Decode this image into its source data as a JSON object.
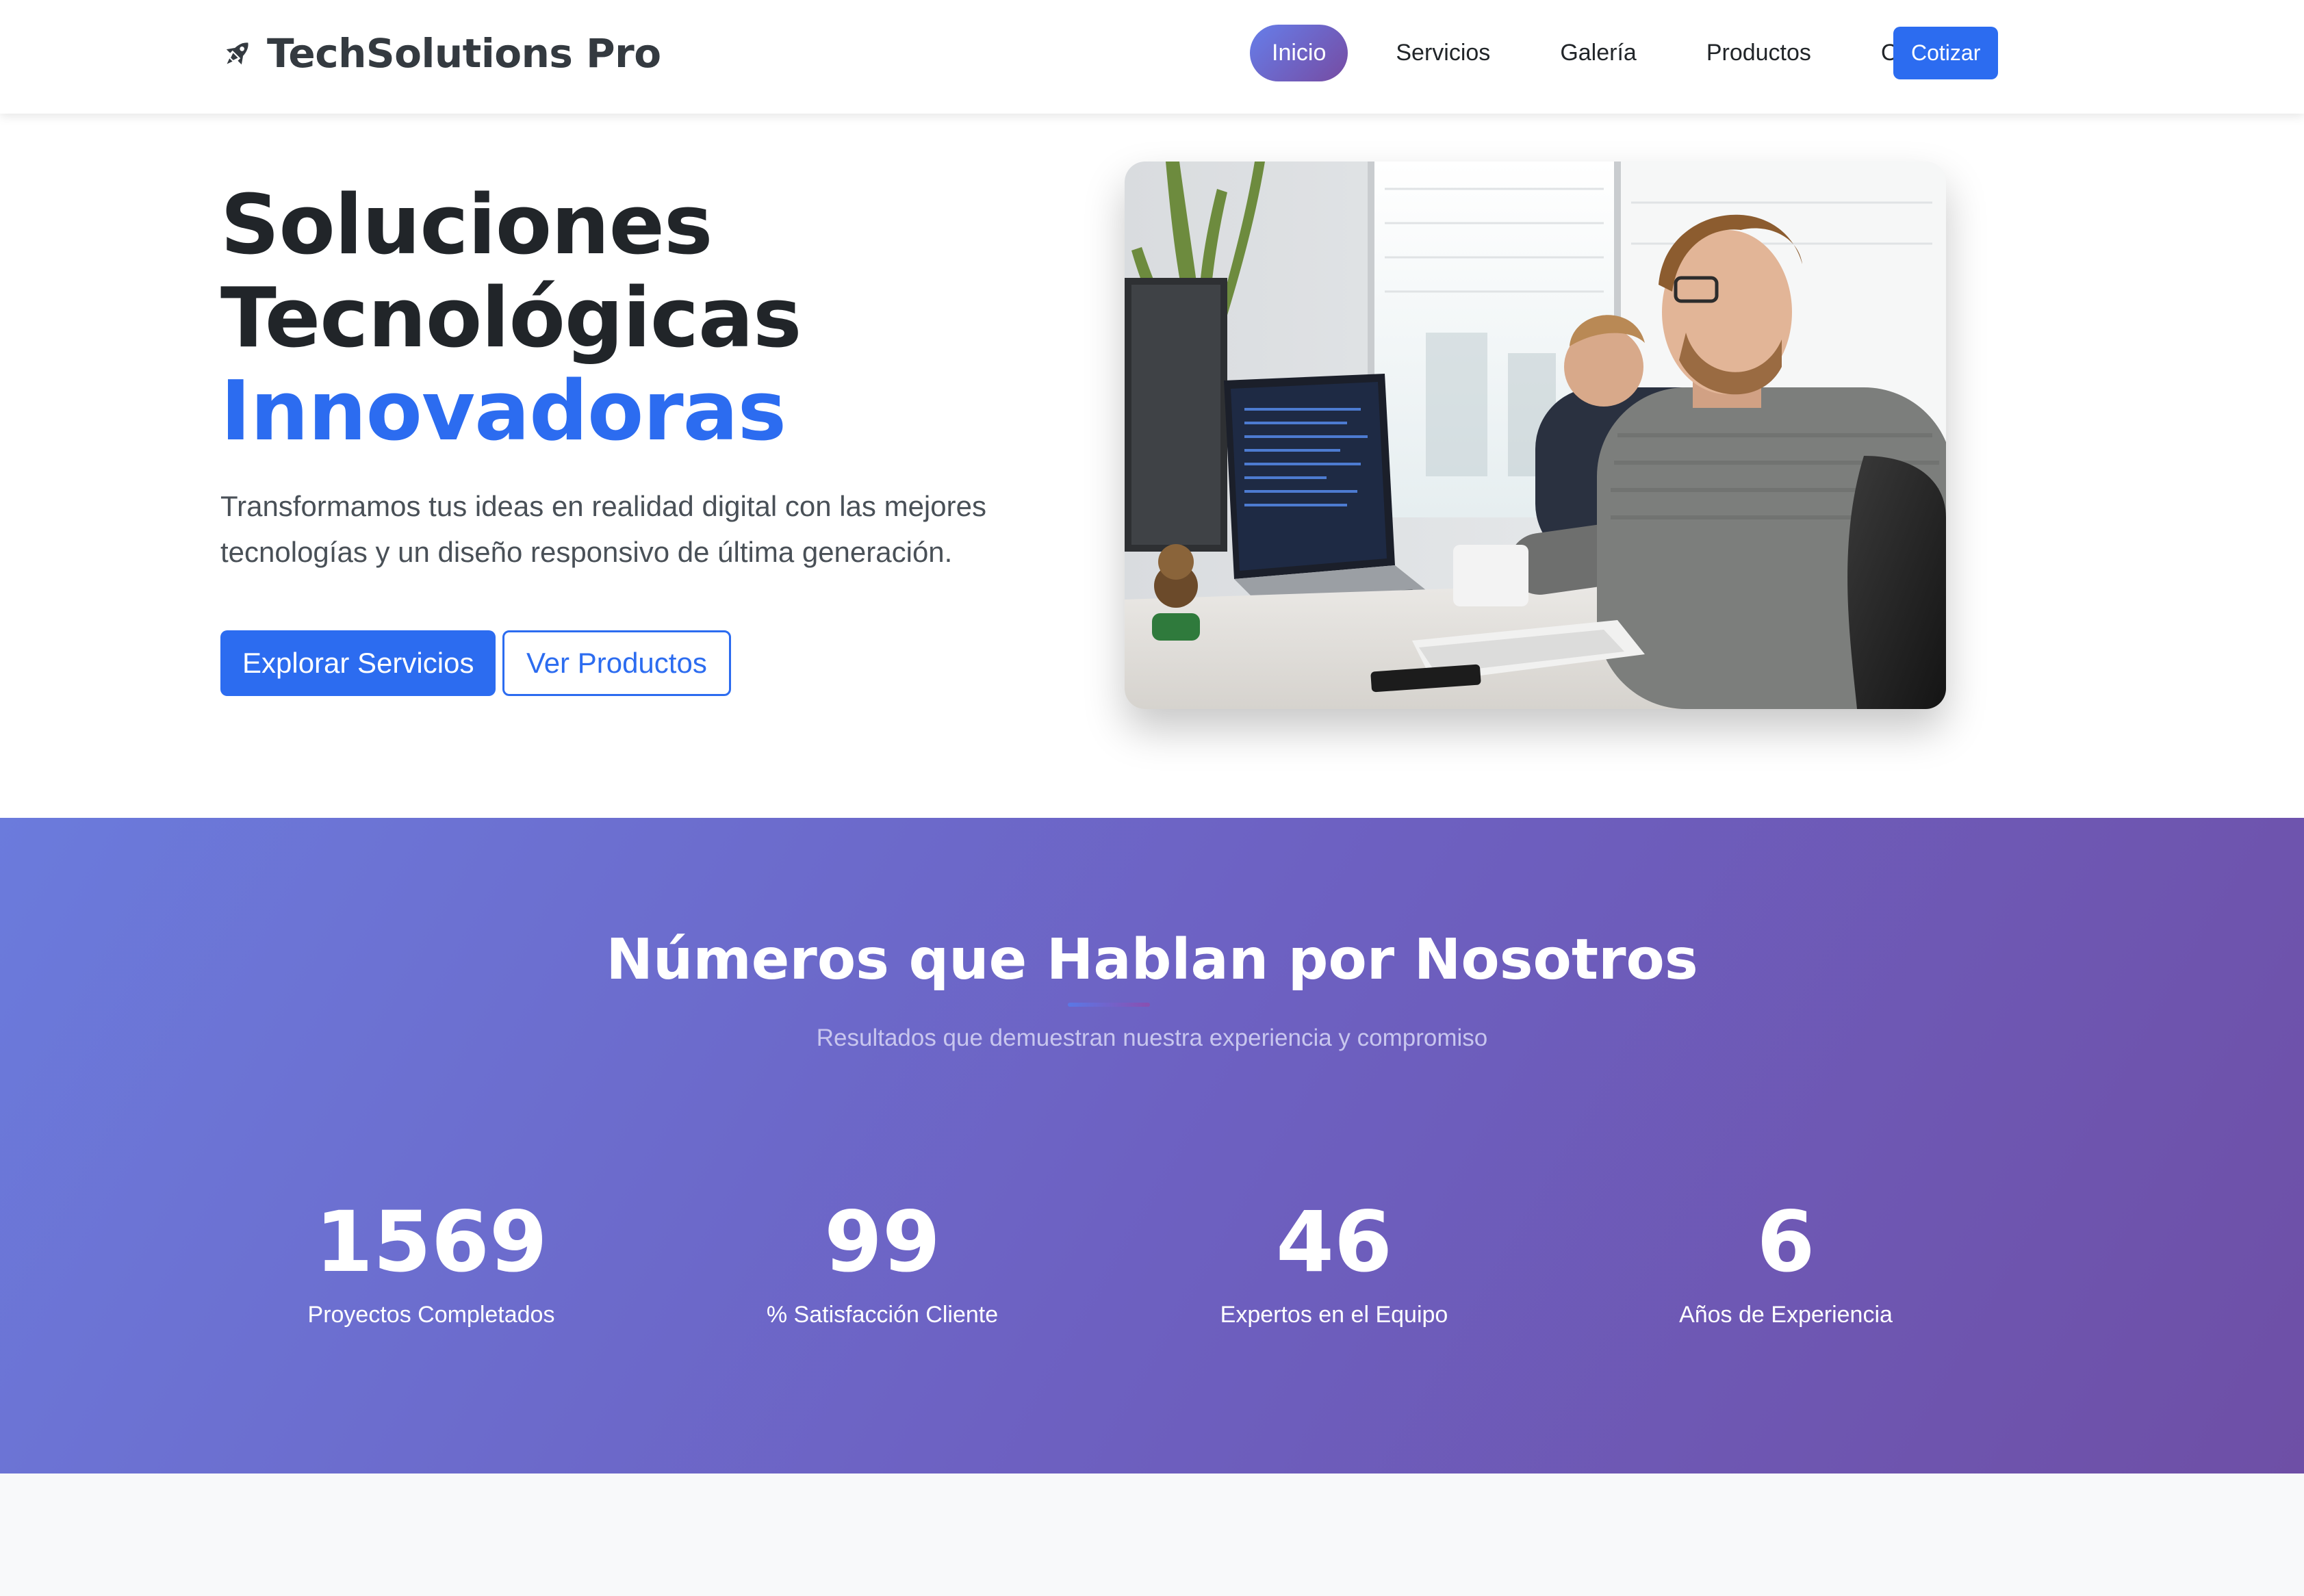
{
  "nav": {
    "brand": "TechSolutions Pro",
    "items": [
      {
        "label": "Inicio",
        "active": true
      },
      {
        "label": "Servicios",
        "active": false
      },
      {
        "label": "Galería",
        "active": false
      },
      {
        "label": "Productos",
        "active": false
      },
      {
        "label": "Contacto",
        "active": false
      }
    ],
    "cta": "Cotizar"
  },
  "hero": {
    "title_line1": "Soluciones",
    "title_line2": "Tecnológicas",
    "title_accent": "Innovadoras",
    "lead": "Transformamos tus ideas en realidad digital con las mejores tecnologías y un diseño responsivo de última generación.",
    "primary_button": "Explorar Servicios",
    "secondary_button": "Ver Productos"
  },
  "stats": {
    "title": "Números que Hablan por Nosotros",
    "subtitle": "Resultados que demuestran nuestra experiencia y compromiso",
    "items": [
      {
        "number": "1569",
        "label": "Proyectos Completados"
      },
      {
        "number": "99",
        "label": "% Satisfacción Cliente"
      },
      {
        "number": "46",
        "label": "Expertos en el Equipo"
      },
      {
        "number": "6",
        "label": "Años de Experiencia"
      }
    ]
  },
  "colors": {
    "primary": "#2c6cf0",
    "gradient_start": "#667eea",
    "gradient_end": "#764ba2",
    "text_dark": "#212529"
  }
}
